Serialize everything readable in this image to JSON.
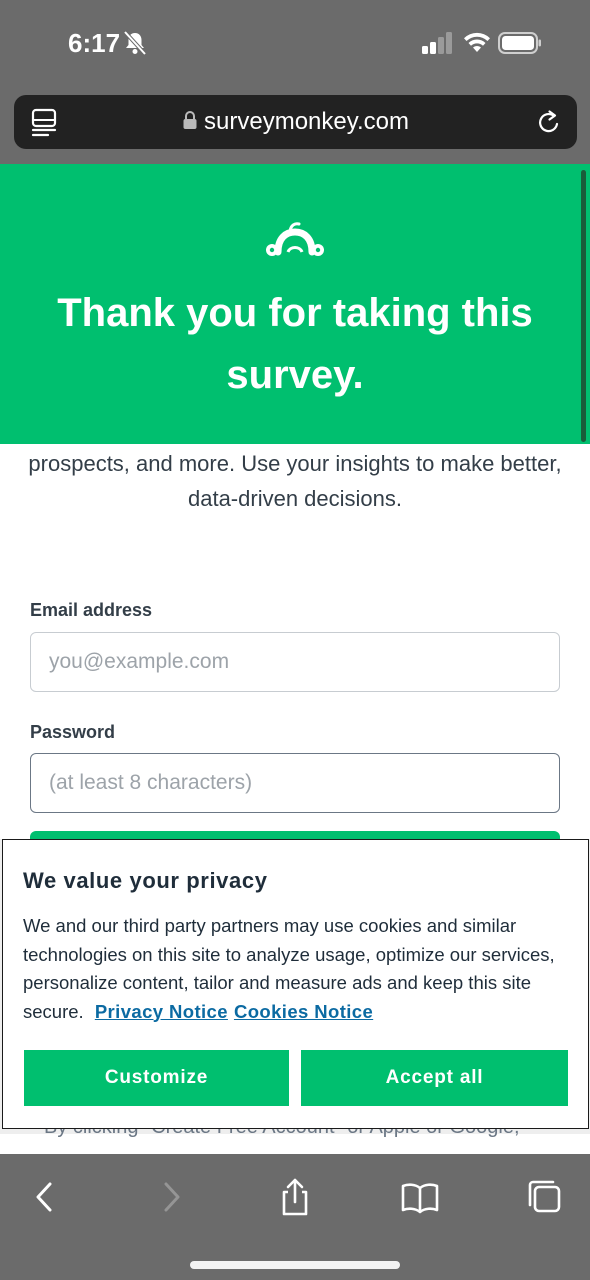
{
  "status_bar": {
    "time": "6:17",
    "icons": [
      "bell-slash-icon",
      "cellular-signal-icon",
      "wifi-icon",
      "battery-icon"
    ]
  },
  "browser": {
    "url": "surveymonkey.com",
    "icons": [
      "reader-mode-icon",
      "lock-icon",
      "reload-icon"
    ]
  },
  "hero": {
    "title": "Thank you for taking this survey.",
    "background": "#00bf6f"
  },
  "page": {
    "blurb": "prospects, and more. Use your insights to make better, data-driven decisions.",
    "email": {
      "label": "Email address",
      "placeholder": "you@example.com"
    },
    "password": {
      "label": "Password",
      "placeholder": "(at least 8 characters)"
    },
    "footer_text": "By clicking \"Create Free Account\" or Apple or Google,"
  },
  "cookie_banner": {
    "title": "We value your privacy",
    "text": "We and our third party partners may use cookies and similar technologies on this site to analyze usage, optimize our services, personalize content, tailor and measure ads and keep this site secure.",
    "privacy_link": "Privacy Notice",
    "cookies_link": "Cookies Notice",
    "customize_label": "Customize",
    "accept_label": "Accept all",
    "link_color": "#0b6aa2"
  },
  "toolbar": {
    "icons": [
      "back-icon",
      "forward-icon",
      "share-icon",
      "bookmarks-icon",
      "tabs-icon"
    ]
  }
}
